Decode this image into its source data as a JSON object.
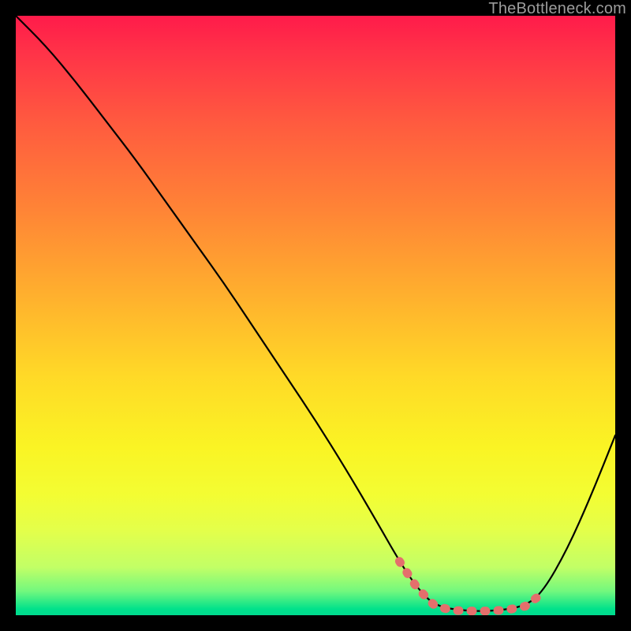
{
  "watermark": "TheBottleneck.com",
  "colors": {
    "bg": "#000000",
    "curve": "#000000",
    "markers": "#e46f6c",
    "gradient_top": "#ff1b4a",
    "gradient_bottom": "#00da8e"
  },
  "chart_data": {
    "type": "line",
    "title": "",
    "xlabel": "",
    "ylabel": "",
    "xlim": [
      0,
      100
    ],
    "ylim": [
      0,
      100
    ],
    "x": [
      0,
      5,
      10,
      15,
      20,
      25,
      30,
      35,
      40,
      45,
      50,
      55,
      60,
      64,
      67,
      70,
      75,
      80,
      85,
      88,
      92,
      96,
      100
    ],
    "values": [
      100,
      95,
      89,
      82.5,
      76,
      69,
      62,
      55,
      47.5,
      40,
      32.5,
      24.5,
      16,
      9,
      4.5,
      1.5,
      0.7,
      0.7,
      1.5,
      4,
      11,
      20,
      30
    ],
    "markers": {
      "x": [
        64,
        67,
        70,
        73,
        76,
        79,
        82,
        85,
        87
      ],
      "y": [
        9,
        4.5,
        1.5,
        0.8,
        0.7,
        0.7,
        0.9,
        1.5,
        3
      ]
    }
  }
}
